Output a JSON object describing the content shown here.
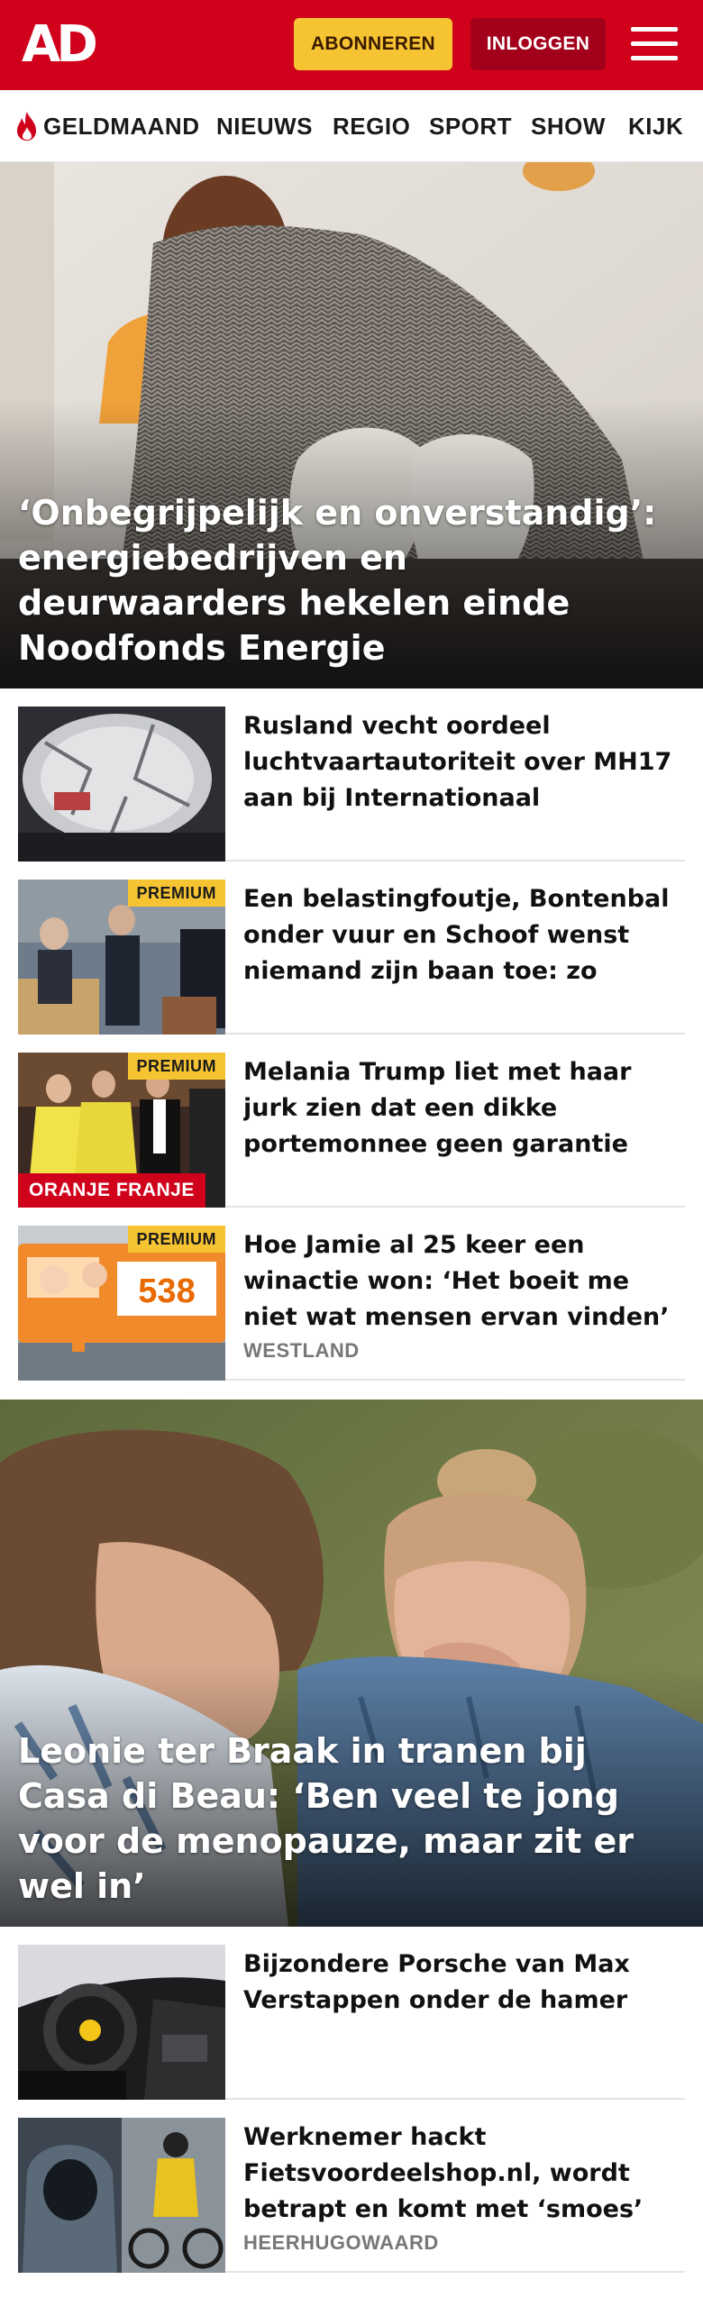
{
  "header": {
    "logo_text": "AD",
    "subscribe_label": "ABONNEREN",
    "login_label": "INLOGGEN",
    "brand_color": "#d0021b"
  },
  "nav": {
    "items": [
      "GELDMAAND",
      "NIEUWS",
      "REGIO",
      "SPORT",
      "SHOW",
      "KIJK"
    ],
    "highlight_icon": "flame-icon"
  },
  "hero1": {
    "title": "‘Onbegrijpelijk en onverstandig’: energiebedrijven en deurwaarders hekelen einde Noodfonds Energie"
  },
  "articles1": [
    {
      "title": "Rusland vecht oordeel luchtvaartautoriteit over MH17 aan bij Internationaal Gerechts-...",
      "premium": "",
      "tag": "",
      "location": ""
    },
    {
      "title": "Een belastingfoutje, Bontenbal onder vuur en Schoof wenst niemand zijn baan toe: zo verlie...",
      "premium": "PREMIUM",
      "tag": "",
      "location": ""
    },
    {
      "title": "Melania Trump liet met haar jurk zien dat een dikke portemonnee geen garantie biedt voor...",
      "premium": "PREMIUM",
      "tag": "ORANJE FRANJE",
      "location": ""
    },
    {
      "title": "Hoe Jamie al 25 keer een winactie won: ‘Het boeit me niet wat mensen ervan vinden’",
      "premium": "PREMIUM",
      "tag": "",
      "location": "WESTLAND"
    }
  ],
  "hero2": {
    "title": "Leonie ter Braak in tranen bij Casa di Beau: ‘Ben veel te jong voor de menopauze, maar zit er wel in’"
  },
  "articles2": [
    {
      "title": "Bijzondere Porsche van Max Verstappen onder de hamer",
      "premium": "",
      "tag": "",
      "location": ""
    },
    {
      "title": "Werknemer hackt Fietsvoordeelshop.nl, wordt betrapt en komt met ‘smoes’ ov...",
      "premium": "",
      "tag": "",
      "location": "HEERHUGOWAARD"
    }
  ],
  "thumb_texts": {
    "bus_number": "538"
  }
}
